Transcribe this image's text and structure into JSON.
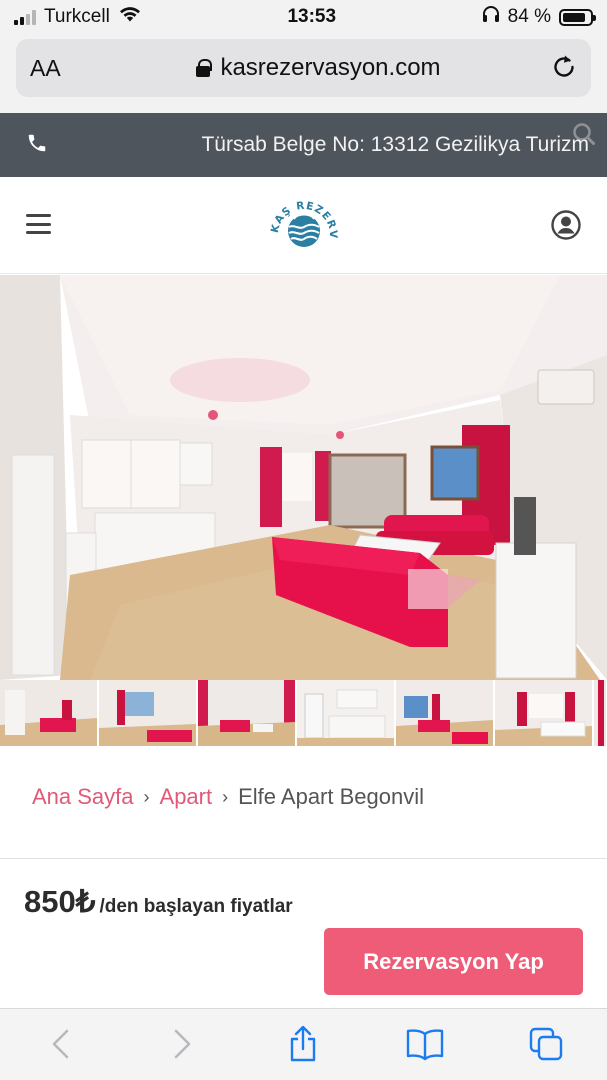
{
  "status_bar": {
    "carrier": "Turkcell",
    "time": "13:53",
    "battery_percent": "84 %",
    "battery_level": 0.84,
    "icons": [
      "signal-icon",
      "wifi-icon",
      "headphones-icon",
      "battery-icon"
    ]
  },
  "browser": {
    "text_size_label": "AA",
    "url": "kasrezervasyon.com",
    "icons": [
      "lock-icon",
      "reload-icon"
    ]
  },
  "top_bar": {
    "marquee_text": "Türsab Belge No: 13312 Gezilikya Turizm",
    "icons": [
      "phone-icon",
      "search-icon"
    ]
  },
  "header": {
    "logo_text": "KAŞ REZERVASYON",
    "icons": [
      "hamburger-menu-icon",
      "user-icon"
    ]
  },
  "gallery": {
    "thumbnail_count": 6
  },
  "breadcrumb": {
    "home": "Ana Sayfa",
    "category": "Apart",
    "current": "Elfe Apart Begonvil",
    "separator": "›"
  },
  "price": {
    "value": "850₺",
    "suffix": "/den başlayan fiyatlar"
  },
  "cta": {
    "reserve_label": "Rezervasyon Yap"
  },
  "colors": {
    "accent": "#ef5c77",
    "link": "#e05a78",
    "top_bar_bg": "#4f555c",
    "logo_blue": "#2a7fa3",
    "ios_blue": "#1a7cf0"
  }
}
